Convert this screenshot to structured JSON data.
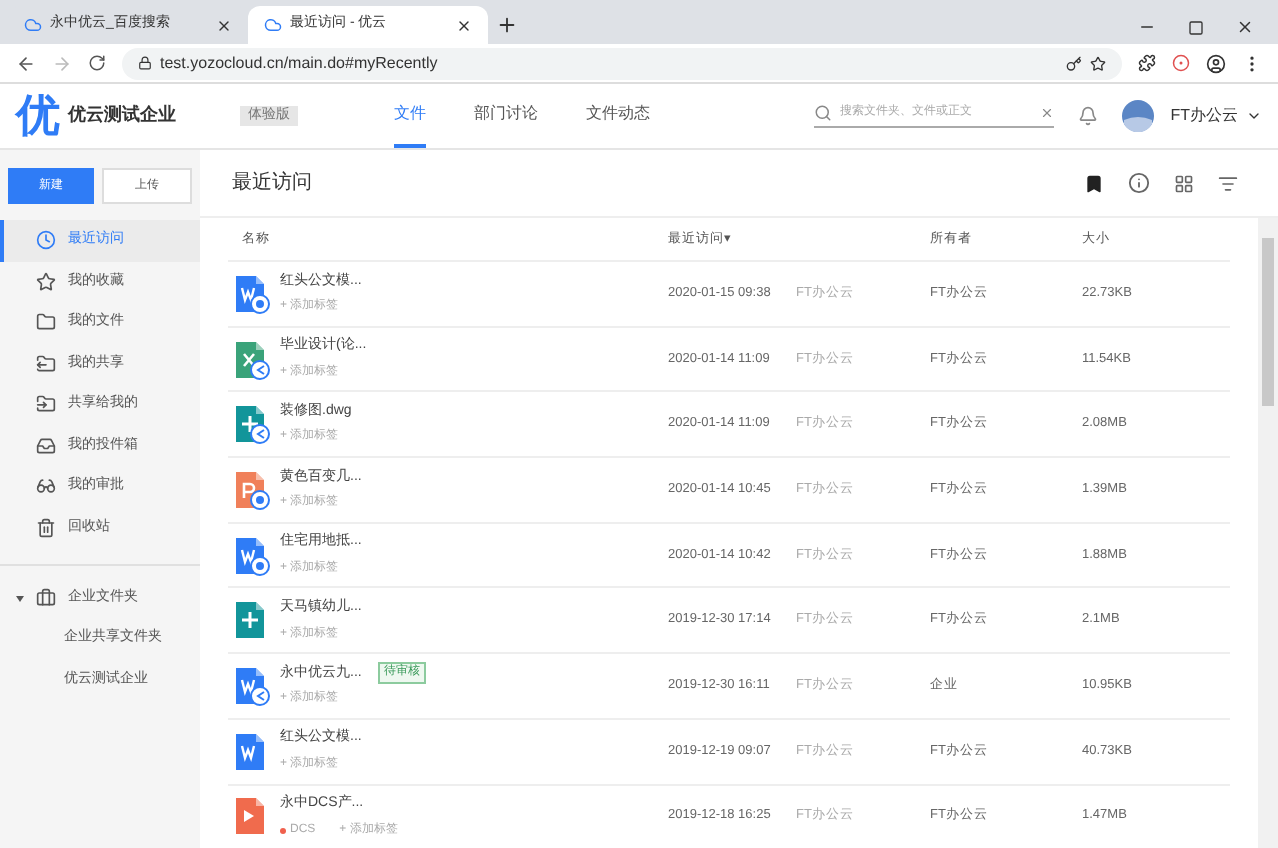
{
  "browser": {
    "tabs": [
      {
        "title": "永中优云_百度搜索",
        "selected": false
      },
      {
        "title": "最近访问 - 优云",
        "selected": true
      }
    ],
    "url": "test.yozocloud.cn/main.do#myRecently"
  },
  "header": {
    "logo": "优",
    "company": "优云测试企业",
    "edition": "体验版",
    "nav": [
      {
        "label": "文件",
        "selected": true
      },
      {
        "label": "部门讨论",
        "selected": false
      },
      {
        "label": "文件动态",
        "selected": false
      }
    ],
    "search": {
      "placeholder": "搜索文件夹、文件或正文"
    },
    "user": "FT办公云"
  },
  "sidebar": {
    "buttons": [
      {
        "label": "新建",
        "kind": "primary"
      },
      {
        "label": "上传",
        "kind": "secondary"
      }
    ],
    "items": [
      {
        "label": "最近访问",
        "selected": true
      },
      {
        "label": "我的收藏",
        "selected": false
      },
      {
        "label": "我的文件",
        "selected": false
      },
      {
        "label": "我的共享",
        "selected": false
      },
      {
        "label": "共享给我的",
        "selected": false
      },
      {
        "label": "我的投件箱",
        "selected": false
      },
      {
        "label": "我的审批",
        "selected": false
      },
      {
        "label": "回收站",
        "selected": false
      }
    ],
    "group": {
      "label": "企业文件夹",
      "expanded": true,
      "children": [
        {
          "label": "企业共享文件夹"
        },
        {
          "label": "优云测试企业"
        }
      ]
    }
  },
  "main": {
    "title": "最近访问",
    "table": {
      "columns": [
        "名称",
        "最近访问",
        "所有者",
        "大小"
      ],
      "sort_mark": "▾",
      "rows": [
        {
          "kind": "word",
          "shared": false,
          "synced": true,
          "name": "红头公文模...",
          "tags": [
            {
              "kind": "add",
              "label": "+ 添加标签"
            }
          ],
          "date": "2020-01-15 09:38",
          "column_3": "FT办公云",
          "owner": "FT办公云",
          "size": "22.73KB"
        },
        {
          "kind": "excel",
          "shared": true,
          "synced": false,
          "name": "毕业设计(论...",
          "tags": [
            {
              "kind": "add",
              "label": "+ 添加标签"
            }
          ],
          "date": "2020-01-14 11:09",
          "column_3": "FT办公云",
          "owner": "FT办公云",
          "size": "11.54KB"
        },
        {
          "kind": "cad",
          "shared": true,
          "synced": false,
          "name": "装修图.dwg",
          "tags": [
            {
              "kind": "add",
              "label": "+ 添加标签"
            }
          ],
          "date": "2020-01-14 11:09",
          "column_3": "FT办公云",
          "owner": "FT办公云",
          "size": "2.08MB"
        },
        {
          "kind": "ppt",
          "shared": false,
          "synced": true,
          "name": "黄色百变几...",
          "tags": [
            {
              "kind": "add",
              "label": "+ 添加标签"
            }
          ],
          "date": "2020-01-14 10:45",
          "column_3": "FT办公云",
          "owner": "FT办公云",
          "size": "1.39MB"
        },
        {
          "kind": "word",
          "shared": false,
          "synced": true,
          "name": "住宅用地抵...",
          "tags": [
            {
              "kind": "add",
              "label": "+ 添加标签"
            }
          ],
          "date": "2020-01-14 10:42",
          "column_3": "FT办公云",
          "owner": "FT办公云",
          "size": "1.88MB"
        },
        {
          "kind": "cad",
          "shared": false,
          "synced": false,
          "name": "天马镇幼儿...",
          "tags": [
            {
              "kind": "add",
              "label": "+ 添加标签"
            }
          ],
          "date": "2019-12-30 17:14",
          "column_3": "FT办公云",
          "owner": "FT办公云",
          "size": "2.1MB"
        },
        {
          "kind": "word",
          "shared": true,
          "synced": false,
          "name": "永中优云九...",
          "status": "待审核",
          "tags": [
            {
              "kind": "add",
              "label": "+ 添加标签"
            }
          ],
          "date": "2019-12-30 16:11",
          "column_3": "FT办公云",
          "owner": "企业",
          "size": "10.95KB"
        },
        {
          "kind": "word",
          "shared": false,
          "synced": false,
          "name": "红头公文模...",
          "tags": [
            {
              "kind": "add",
              "label": "+ 添加标签"
            }
          ],
          "date": "2019-12-19 09:07",
          "column_3": "FT办公云",
          "owner": "FT办公云",
          "size": "40.73KB"
        },
        {
          "kind": "pdf",
          "shared": false,
          "synced": false,
          "name": "永中DCS产...",
          "tags": [
            {
              "kind": "tag",
              "label": "DCS",
              "color": "#f0604d"
            },
            {
              "kind": "add",
              "label": "+ 添加标签"
            }
          ],
          "date": "2019-12-18 16:25",
          "column_3": "FT办公云",
          "owner": "FT办公云",
          "size": "1.47MB"
        }
      ]
    }
  }
}
